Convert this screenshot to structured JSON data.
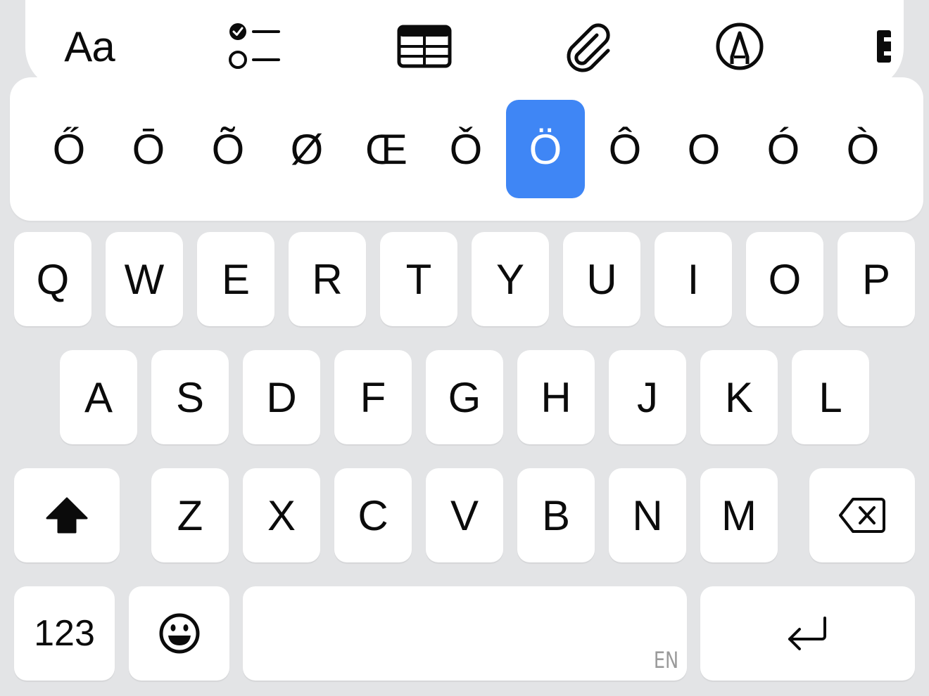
{
  "toolbar": {
    "format_label": "Aa",
    "icons": [
      "format-text-icon",
      "checklist-icon",
      "table-icon",
      "attachment-icon",
      "markup-pen-icon",
      "more-icon"
    ]
  },
  "accent_popup": {
    "options": [
      "Ő",
      "Ō",
      "Õ",
      "Ø",
      "Œ",
      "Ǒ",
      "Ö",
      "Ô",
      "O",
      "Ó",
      "Ò"
    ],
    "selected": "Ö",
    "selected_color": "#3f86f5"
  },
  "keyboard": {
    "row1": [
      "Q",
      "W",
      "E",
      "R",
      "T",
      "Y",
      "U",
      "I",
      "O",
      "P"
    ],
    "row2": [
      "A",
      "S",
      "D",
      "F",
      "G",
      "H",
      "J",
      "K",
      "L"
    ],
    "row3": [
      "Z",
      "X",
      "C",
      "V",
      "B",
      "N",
      "M"
    ],
    "numbers_label": "123",
    "space_language": "EN",
    "icons": {
      "shift": "shift-icon",
      "delete": "delete-icon",
      "emoji": "emoji-icon",
      "return": "return-icon"
    }
  }
}
